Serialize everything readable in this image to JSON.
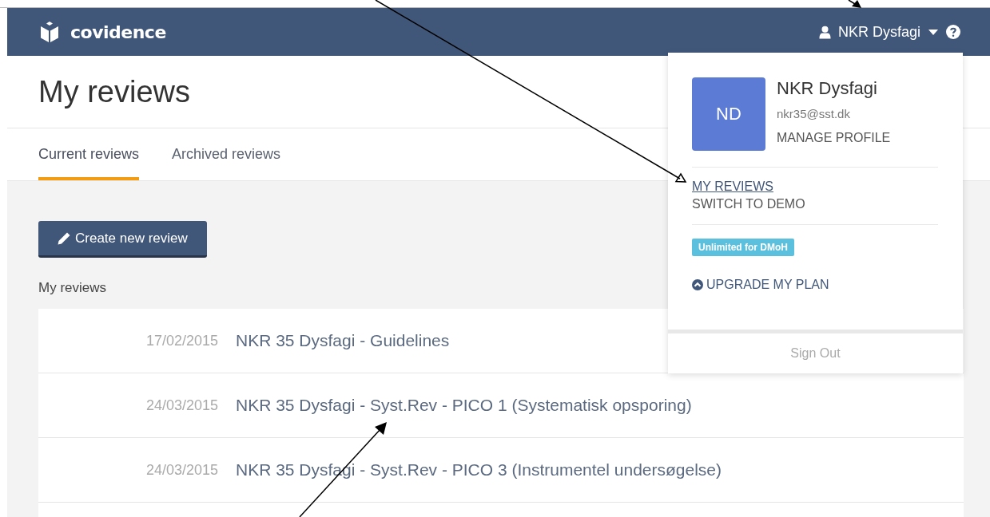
{
  "navbar": {
    "brand": "covidence",
    "user_name": "NKR Dysfagi"
  },
  "page_title": "My reviews",
  "tabs": [
    {
      "label": "Current reviews",
      "selected": true
    },
    {
      "label": "Archived reviews",
      "selected": false
    }
  ],
  "create_button": "Create new review",
  "section_label": "My reviews",
  "reviews": [
    {
      "date": "17/02/2015",
      "title": "NKR 35 Dysfagi - Guidelines"
    },
    {
      "date": "24/03/2015",
      "title": "NKR 35 Dysfagi - Syst.Rev - PICO 1 (Systematisk opsporing)"
    },
    {
      "date": "24/03/2015",
      "title": "NKR 35 Dysfagi - Syst.Rev - PICO 3 (Instrumentel undersøgelse)"
    }
  ],
  "user_dropdown": {
    "initials": "ND",
    "name": "NKR Dysfagi",
    "email": "nkr35@sst.dk",
    "manage_profile": "MANAGE PROFILE",
    "menu_items": [
      {
        "label": "MY REVIEWS",
        "hovered": true
      },
      {
        "label": "SWITCH TO DEMO",
        "hovered": false
      }
    ],
    "plan_badge": "Unlimited for DMoH",
    "upgrade_link": "UPGRADE MY PLAN",
    "sign_out": "Sign Out"
  }
}
